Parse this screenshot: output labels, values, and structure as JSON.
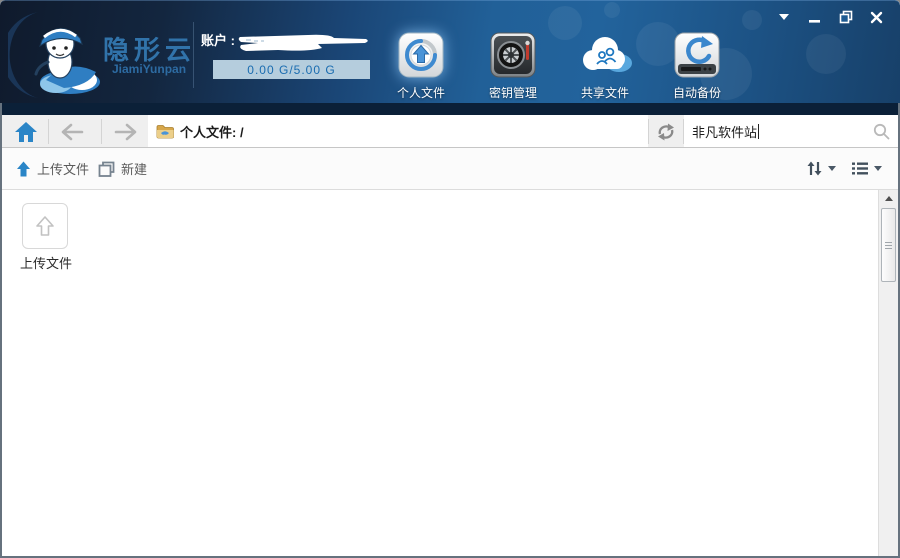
{
  "brand": {
    "name": "隐形云",
    "latin": "JiamiYunpan"
  },
  "account": {
    "label": "账户 :",
    "quota": "0.00 G/5.00 G"
  },
  "main_nav": {
    "items": [
      {
        "label": "个人文件",
        "icon": "personal-files-icon",
        "active": true
      },
      {
        "label": "密钥管理",
        "icon": "key-management-icon",
        "active": false
      },
      {
        "label": "共享文件",
        "icon": "shared-files-icon",
        "active": false
      },
      {
        "label": "自动备份",
        "icon": "auto-backup-icon",
        "active": false
      }
    ]
  },
  "window_controls": {
    "items": [
      "menu-icon",
      "minimize-icon",
      "restore-icon",
      "close-icon"
    ]
  },
  "navbar": {
    "breadcrumb": "个人文件:  /",
    "icons": [
      "home-icon",
      "back-icon",
      "forward-icon",
      "folder-icon",
      "refresh-icon",
      "search-icon"
    ],
    "search": {
      "value": "非凡软件站"
    }
  },
  "toolbar": {
    "upload_label": "上传文件",
    "new_label": "新建",
    "icons": [
      "upload-arrow-icon",
      "new-file-icon",
      "sort-icon",
      "list-view-icon"
    ]
  },
  "content": {
    "upload_tile_label": "上传文件"
  },
  "colors": {
    "accent_blue": "#2a7fc1",
    "header_dark": "#13263f",
    "header_blue": "#216098",
    "header_strip": "#0b2038",
    "quota_bg": "#b5cddd",
    "quota_text": "#1a6cb0",
    "navbar_bg": "#efefef",
    "toolbar_bg": "#fbfbfb"
  }
}
